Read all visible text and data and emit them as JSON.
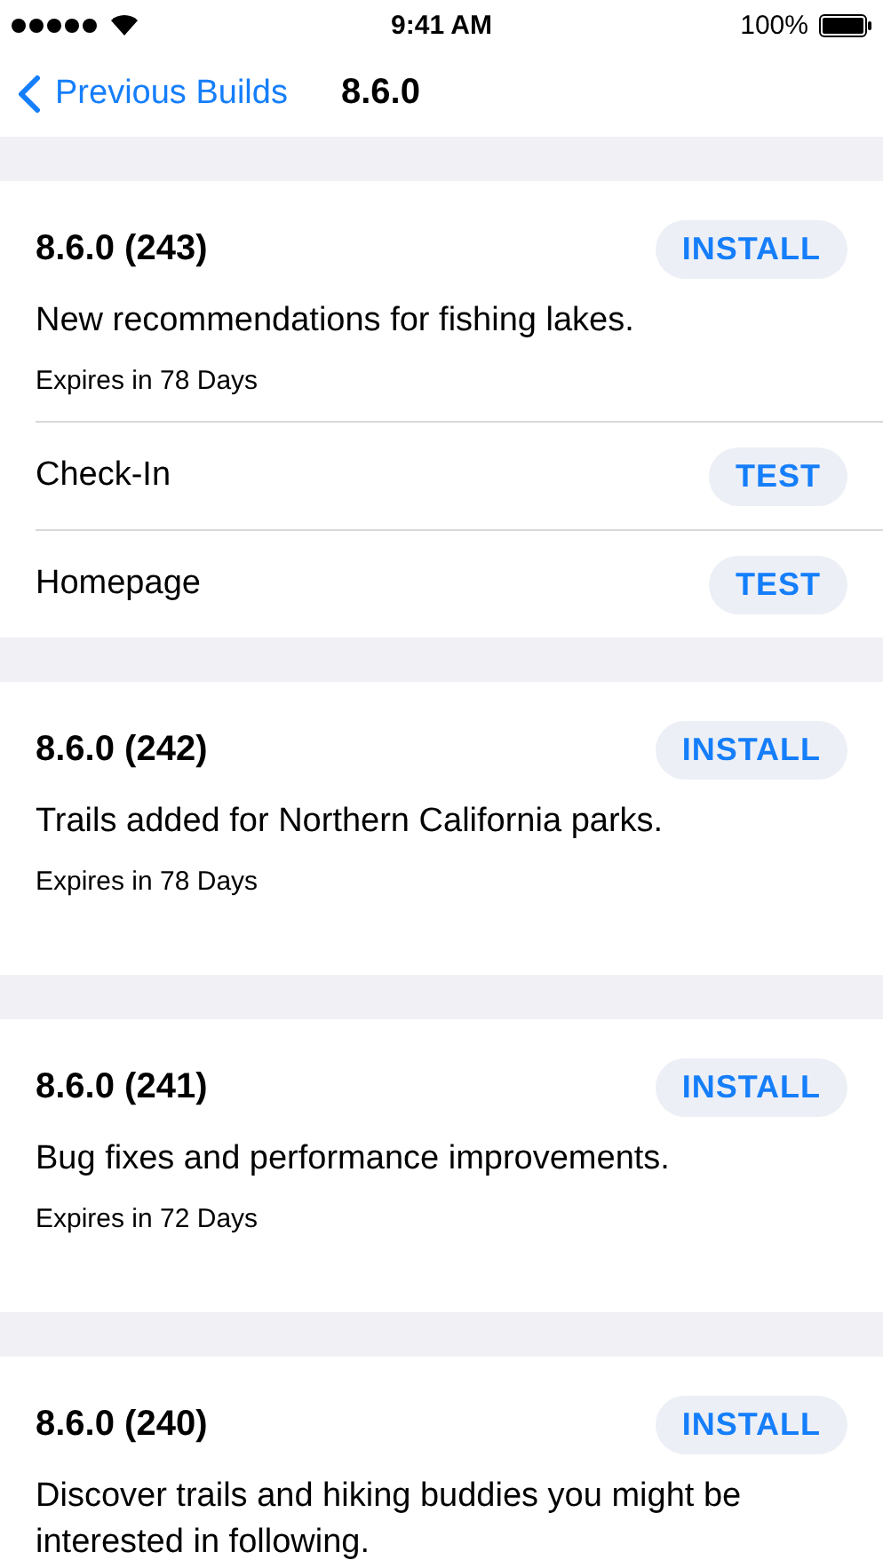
{
  "status_bar": {
    "time": "9:41 AM",
    "battery": "100%"
  },
  "nav": {
    "back": "Previous Builds",
    "title": "8.6.0"
  },
  "builds": [
    {
      "title": "8.6.0 (243)",
      "button": "INSTALL",
      "description": "New recommendations for fishing lakes.",
      "expires": "Expires in 78 Days",
      "rows": [
        {
          "label": "Check-In",
          "button": "TEST"
        },
        {
          "label": "Homepage",
          "button": "TEST"
        }
      ]
    },
    {
      "title": "8.6.0 (242)",
      "button": "INSTALL",
      "description": "Trails added for Northern California parks.",
      "expires": "Expires in 78 Days"
    },
    {
      "title": "8.6.0 (241)",
      "button": "INSTALL",
      "description": "Bug fixes and performance improvements.",
      "expires": "Expires in 72 Days"
    },
    {
      "title": "8.6.0 (240)",
      "button": "INSTALL",
      "description": "Discover trails and hiking buddies you might be interested in following."
    }
  ]
}
